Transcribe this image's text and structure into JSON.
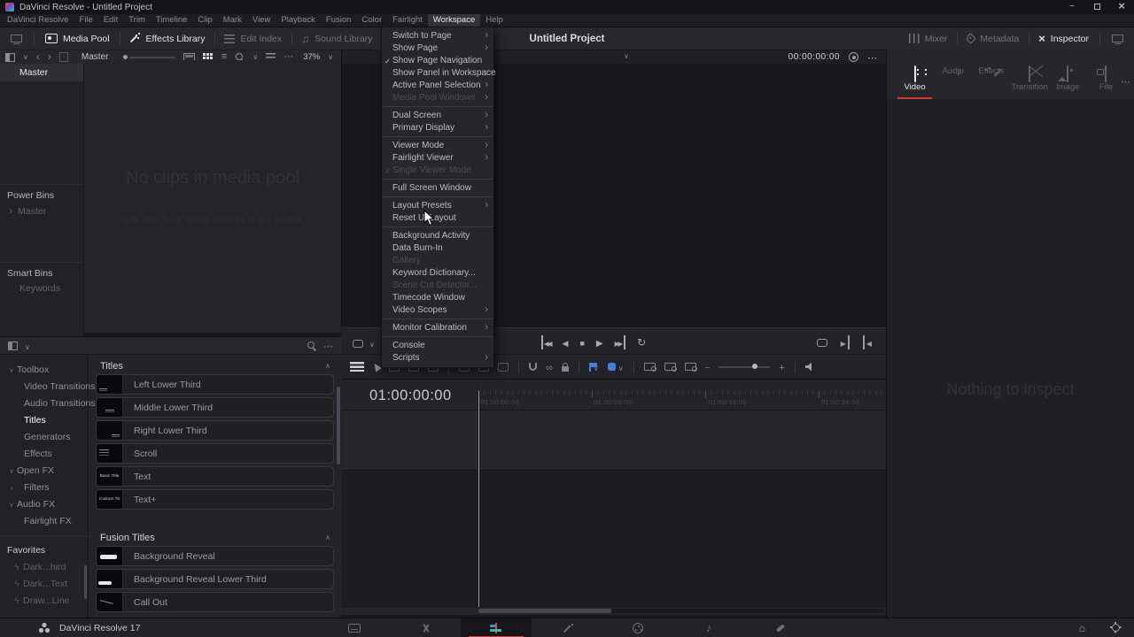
{
  "window": {
    "title": "DaVinci Resolve - Untitled Project"
  },
  "menu_bar": {
    "items": [
      {
        "label": "DaVinci Resolve"
      },
      {
        "label": "File"
      },
      {
        "label": "Edit"
      },
      {
        "label": "Trim"
      },
      {
        "label": "Timeline"
      },
      {
        "label": "Clip"
      },
      {
        "label": "Mark"
      },
      {
        "label": "View"
      },
      {
        "label": "Playback"
      },
      {
        "label": "Fusion"
      },
      {
        "label": "Color"
      },
      {
        "label": "Fairlight"
      },
      {
        "label": "Workspace",
        "active": true
      },
      {
        "label": "Help"
      }
    ]
  },
  "workspace_menu": {
    "items": [
      {
        "label": "Switch to Page",
        "sub": true
      },
      {
        "label": "Show Page",
        "sub": true
      },
      {
        "label": "Show Page Navigation",
        "checked": true
      },
      {
        "label": "Show Panel in Workspace",
        "sub": true
      },
      {
        "label": "Active Panel Selection",
        "sub": true
      },
      {
        "label": "Media Pool Windows",
        "sub": true,
        "disabled": true
      },
      {
        "sep": true
      },
      {
        "label": "Dual Screen",
        "sub": true
      },
      {
        "label": "Primary Display",
        "sub": true
      },
      {
        "sep": true
      },
      {
        "label": "Viewer Mode",
        "sub": true
      },
      {
        "label": "Fairlight Viewer",
        "sub": true
      },
      {
        "label": "Single Viewer Mode",
        "checked": true,
        "disabled": true
      },
      {
        "sep": true
      },
      {
        "label": "Full Screen Window"
      },
      {
        "sep": true
      },
      {
        "label": "Layout Presets",
        "sub": true
      },
      {
        "label": "Reset UI Layout"
      },
      {
        "sep": true
      },
      {
        "label": "Background Activity"
      },
      {
        "label": "Data Burn-In"
      },
      {
        "label": "Gallery",
        "disabled": true
      },
      {
        "label": "Keyword Dictionary..."
      },
      {
        "label": "Scene Cut Detector...",
        "disabled": true
      },
      {
        "label": "Timecode Window"
      },
      {
        "label": "Video Scopes",
        "sub": true
      },
      {
        "sep": true
      },
      {
        "label": "Monitor Calibration",
        "sub": true
      },
      {
        "sep": true
      },
      {
        "label": "Console"
      },
      {
        "label": "Scripts",
        "sub": true
      }
    ]
  },
  "toolbar": {
    "left": [
      {
        "label": "Media Pool",
        "icon": "s-mediapool",
        "active": true
      },
      {
        "label": "Effects Library",
        "icon": "s-wand",
        "active": true
      },
      {
        "label": "Edit Index",
        "icon": "s-editindex"
      },
      {
        "label": "Sound Library",
        "icon": "g-notes"
      }
    ],
    "right": [
      {
        "label": "Mixer",
        "icon": "s-mixer"
      },
      {
        "label": "Metadata",
        "icon": "s-tag"
      },
      {
        "label": "Inspector",
        "icon": "g-x",
        "active": true
      }
    ]
  },
  "viewer": {
    "title": "Untitled Project",
    "timecode": "00:00:00:00"
  },
  "media_pool": {
    "bin_label": "Master",
    "zoom_level": "37%",
    "sidebar": {
      "top_item": "Master",
      "power_bins_header": "Power Bins",
      "power_bins_item": "Master",
      "smart_bins_header": "Smart Bins",
      "smart_bins_item": "Keywords"
    },
    "empty_title": "No clips in media pool",
    "empty_subtitle": "Add clips from Media Storage to get started"
  },
  "effects_library": {
    "tree": [
      {
        "label": "Toolbox",
        "arrow": "∨",
        "group": true
      },
      {
        "label": "Video Transitions",
        "child": true
      },
      {
        "label": "Audio Transitions",
        "child": true
      },
      {
        "label": "Titles",
        "child": true,
        "selected": true
      },
      {
        "label": "Generators",
        "child": true
      },
      {
        "label": "Effects",
        "child": true
      },
      {
        "label": "Open FX",
        "arrow": "∨",
        "group": true
      },
      {
        "label": "Filters",
        "arrow": "›",
        "child": true
      },
      {
        "label": "Audio FX",
        "arrow": "∨",
        "group": true
      },
      {
        "label": "Fairlight FX",
        "child": true
      }
    ],
    "favorites_header": "Favorites",
    "favorites": [
      {
        "label": "Dark...hird"
      },
      {
        "label": "Dark...Text"
      },
      {
        "label": "Draw...Line"
      }
    ],
    "titles_header": "Titles",
    "titles": [
      {
        "label": "Left Lower Third",
        "thumb_text": "",
        "pos": "pos-left"
      },
      {
        "label": "Middle Lower Third",
        "thumb_text": "",
        "pos": "pos-center"
      },
      {
        "label": "Right Lower Third",
        "thumb_text": "",
        "pos": "pos-right"
      },
      {
        "label": "Scroll",
        "thumb_text": "",
        "pos": "pos-lines"
      },
      {
        "label": "Text",
        "thumb_text": "Basic Title",
        "pos": "pos-title"
      },
      {
        "label": "Text+",
        "thumb_text": "Custom Title",
        "pos": "pos-title"
      }
    ],
    "fusion_titles_header": "Fusion Titles",
    "fusion_titles": [
      {
        "label": "Background Reveal",
        "thumb_text": "",
        "pos": "pill-center"
      },
      {
        "label": "Background Reveal Lower Third",
        "thumb_text": "",
        "pos": "pill-bottom"
      },
      {
        "label": "Call Out",
        "thumb_text": "",
        "pos": "pos-callout"
      }
    ]
  },
  "timeline": {
    "timecode": "01:00:00:00",
    "ruler_labels": [
      "01:00:00:00",
      "01:00:08:00",
      "01:00:16:00",
      "01:00:24:00"
    ]
  },
  "inspector": {
    "tabs": [
      {
        "label": "Video",
        "icon": "video-tab-icon",
        "active": true
      },
      {
        "label": "Audio",
        "icon": "audio-tab-icon"
      },
      {
        "label": "Effects",
        "icon": "effects-tab-icon"
      },
      {
        "label": "Transition",
        "icon": "transition-tab-icon"
      },
      {
        "label": "Image",
        "icon": "image-tab-icon"
      },
      {
        "label": "File",
        "icon": "file-tab-icon"
      }
    ],
    "empty_text": "Nothing to inspect"
  },
  "status_bar": {
    "app_label": "DaVinci Resolve 17",
    "pages": [
      {
        "name": "media",
        "icon": "pg-media"
      },
      {
        "name": "cut",
        "icon": "pg-cut"
      },
      {
        "name": "edit",
        "icon": "pg-edit",
        "active": true
      },
      {
        "name": "fusion",
        "icon": "pg-fusion"
      },
      {
        "name": "color",
        "icon": "pg-color"
      },
      {
        "name": "fairlight",
        "icon": "pg-fairlight"
      },
      {
        "name": "deliver",
        "icon": "pg-deliver"
      }
    ]
  },
  "colors": {
    "accent_red": "#cb3a31",
    "accent_blue": "#4080e0",
    "panel_bg": "#27272c",
    "dark_bg": "#18181c"
  }
}
